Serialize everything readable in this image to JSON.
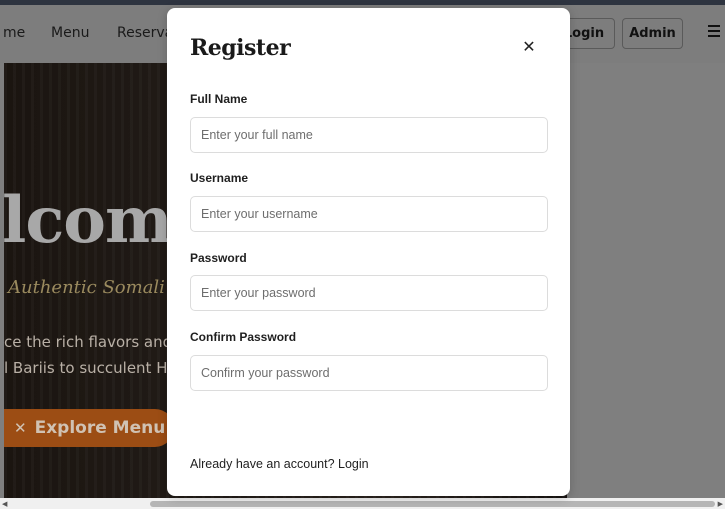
{
  "navbar": {
    "links": [
      "me",
      "Menu",
      "Reserva"
    ],
    "login_label": "Login",
    "admin_label": "Admin",
    "menu_icon": "hamburger-icon"
  },
  "hero": {
    "title": "lcome",
    "subtitle": "Authentic Somali Cu",
    "text_line1": "ce the rich flavors and",
    "text_line2": "l Bariis to succulent Hi",
    "cta_label": "Explore Menu",
    "cta_icon": "utensils-icon",
    "cta_color": "#9c4d14"
  },
  "modal": {
    "title": "Register",
    "close_icon": "close-icon",
    "fields": [
      {
        "label": "Full Name",
        "placeholder": "Enter your full name"
      },
      {
        "label": "Username",
        "placeholder": "Enter your username"
      },
      {
        "label": "Password",
        "placeholder": "Enter your password"
      },
      {
        "label": "Confirm Password",
        "placeholder": "Confirm your password"
      }
    ],
    "footer_text": "Already have an account?",
    "footer_link": "Login"
  }
}
